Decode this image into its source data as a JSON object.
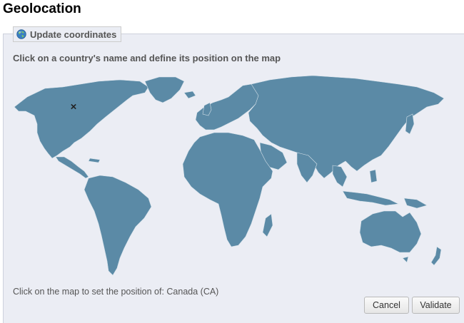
{
  "page": {
    "title": "Geolocation"
  },
  "panel": {
    "legend_label": "Update coordinates",
    "legend_icon": "globe-icon",
    "instruction": "Click on a country's name and define its position on the map"
  },
  "map": {
    "fill_color": "#5b8aa6",
    "marker_symbol": "×",
    "marker_icon": "x-marker-icon"
  },
  "status": {
    "position_text": "Click on the map to set the position of: Canada (CA)"
  },
  "buttons": {
    "cancel_label": "Cancel",
    "validate_label": "Validate"
  }
}
